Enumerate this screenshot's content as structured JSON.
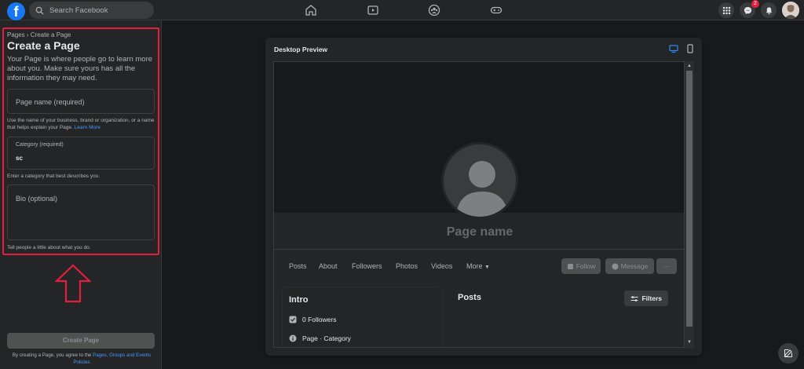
{
  "topbar": {
    "search_placeholder": "Search Facebook",
    "messenger_badge": "2",
    "nav_icons": [
      "home-icon",
      "watch-icon",
      "groups-icon",
      "gaming-icon"
    ],
    "menu_icons": [
      "menu-grid-icon",
      "messenger-icon",
      "notifications-icon"
    ]
  },
  "left_panel": {
    "breadcrumb": "Pages › Create a Page",
    "title": "Create a Page",
    "description": "Your Page is where people go to learn more about you. Make sure yours has all the information they may need.",
    "page_name_placeholder": "Page name (required)",
    "page_name_hint": "Use the name of your business, brand or organization, or a name that helps explain your Page.",
    "learn_more": "Learn More",
    "category_label": "Category (required)",
    "category_value": "sc",
    "category_hint": "Enter a category that best describes you.",
    "bio_placeholder": "Bio (optional)",
    "bio_hint": "Tell people a little about what you do.",
    "create_button": "Create Page",
    "terms_prefix": "By creating a Page, you agree to the",
    "terms_link": "Pages, Groups and Events Policies",
    "highlight_color": "#e41e3f"
  },
  "preview": {
    "title": "Desktop Preview",
    "page_name": "Page name",
    "tabs": [
      "Posts",
      "About",
      "Followers",
      "Photos",
      "Videos",
      "More"
    ],
    "follow_button": "Follow",
    "message_button": "Message",
    "more_button": "···",
    "intro_title": "Intro",
    "followers": "0 Followers",
    "category": "Page · Category",
    "posts_title": "Posts",
    "filters_button": "Filters"
  },
  "colors": {
    "accent": "#1877f2",
    "background": "#18191a",
    "surface": "#242526",
    "link": "#4599ff"
  }
}
